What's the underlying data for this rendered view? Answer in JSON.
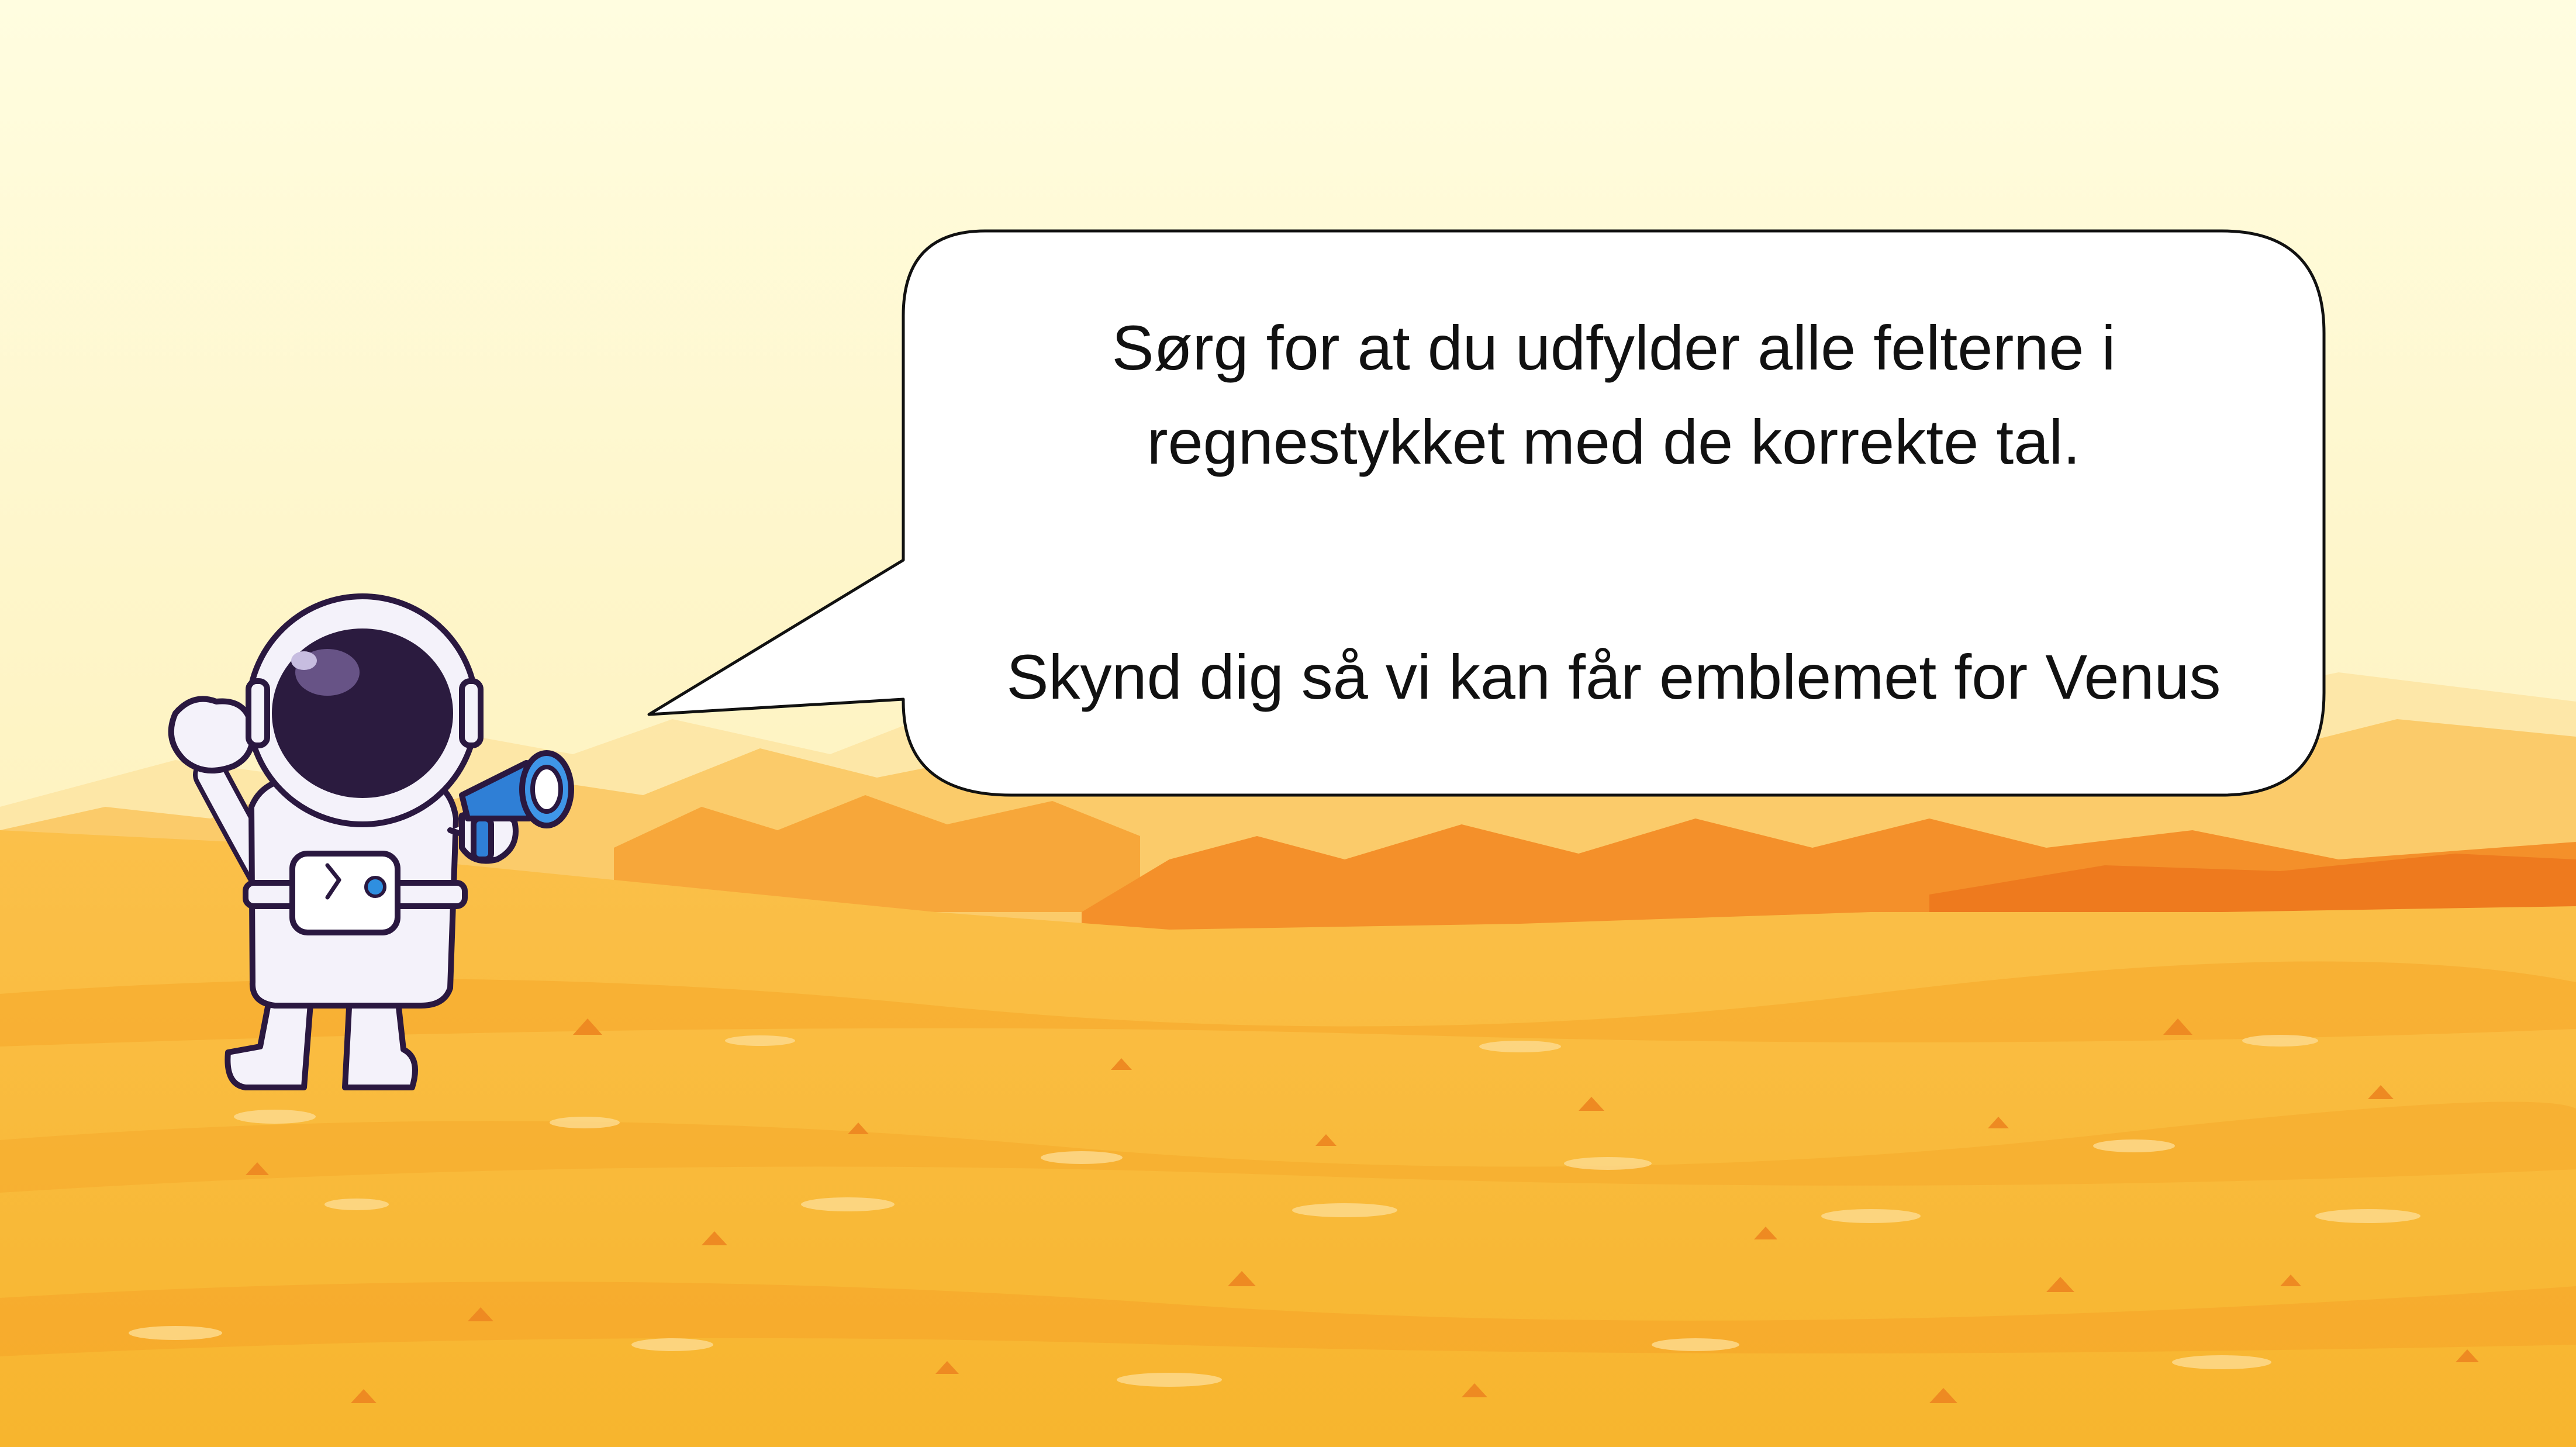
{
  "speech_bubble": {
    "line1": "Sørg for at du udfylder alle felterne i",
    "line2": "regnestykket med de korrekte tal.",
    "line3": "Skynd dig så vi kan får emblemet for Venus"
  },
  "illustration": {
    "character": "astronaut-with-megaphone",
    "background": "orange-desert-planet-landscape"
  },
  "colors": {
    "sky_top": "#FFFDE0",
    "sky_bottom": "#FDE9A8",
    "ground": "#F9B73A",
    "ground_dark": "#F08A1C",
    "helmet_visor": "#2B1B3F",
    "megaphone": "#2F7FD6"
  }
}
